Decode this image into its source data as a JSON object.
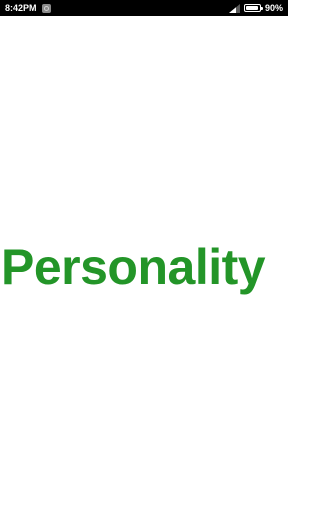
{
  "status_bar": {
    "time": "8:42PM",
    "battery_text": "90%",
    "battery_level": 0.9
  },
  "main": {
    "title": "Personality",
    "title_color": "#239528"
  },
  "icons": {
    "notification": "notification-icon",
    "signal": "signal-strength-icon",
    "battery": "battery-icon"
  }
}
